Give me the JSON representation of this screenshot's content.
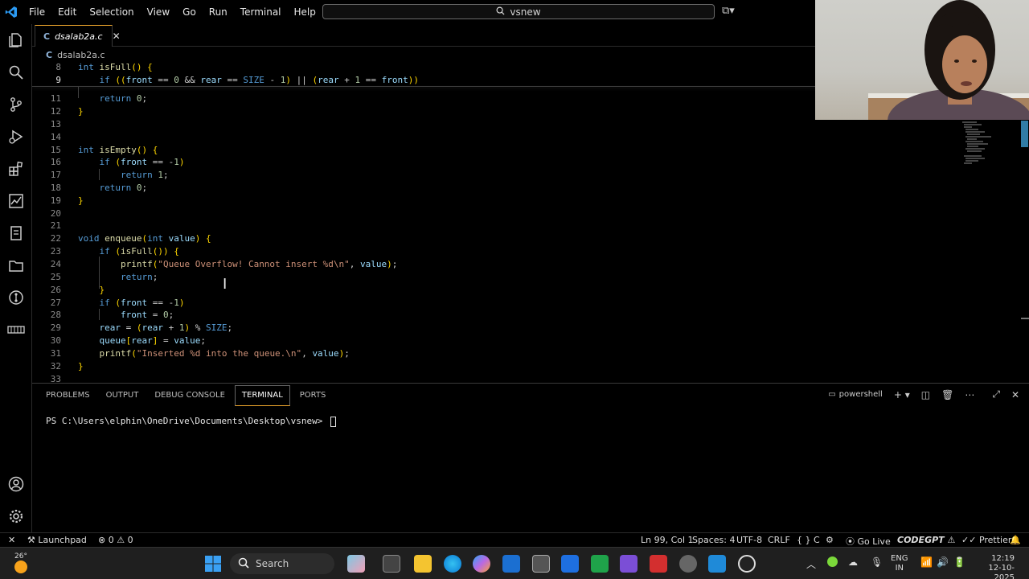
{
  "menu": [
    "File",
    "Edit",
    "Selection",
    "View",
    "Go",
    "Run",
    "Terminal",
    "Help"
  ],
  "command_center": {
    "text": "vsnew"
  },
  "tab": {
    "label": "dsalab2a.c",
    "lang_glyph": "C"
  },
  "breadcrumb": {
    "file": "dsalab2a.c"
  },
  "code_lines": [
    {
      "n": "8",
      "text": "int isFull() {"
    },
    {
      "n": "9",
      "text": "    if ((front == 0 && rear == SIZE - 1) || (rear + 1 == front))"
    },
    {
      "n": "11",
      "text": "    return 0;"
    },
    {
      "n": "12",
      "text": "}"
    },
    {
      "n": "13",
      "text": ""
    },
    {
      "n": "14",
      "text": ""
    },
    {
      "n": "15",
      "text": "int isEmpty() {"
    },
    {
      "n": "16",
      "text": "    if (front == -1)"
    },
    {
      "n": "17",
      "text": "        return 1;"
    },
    {
      "n": "18",
      "text": "    return 0;"
    },
    {
      "n": "19",
      "text": "}"
    },
    {
      "n": "20",
      "text": ""
    },
    {
      "n": "21",
      "text": ""
    },
    {
      "n": "22",
      "text": "void enqueue(int value) {"
    },
    {
      "n": "23",
      "text": "    if (isFull()) {"
    },
    {
      "n": "24",
      "text": "        printf(\"Queue Overflow! Cannot insert %d\\n\", value);"
    },
    {
      "n": "25",
      "text": "        return;"
    },
    {
      "n": "26",
      "text": "    }"
    },
    {
      "n": "27",
      "text": "    if (front == -1)"
    },
    {
      "n": "28",
      "text": "        front = 0;"
    },
    {
      "n": "29",
      "text": "    rear = (rear + 1) % SIZE;"
    },
    {
      "n": "30",
      "text": "    queue[rear] = value;"
    },
    {
      "n": "31",
      "text": "    printf(\"Inserted %d into the queue.\\n\", value);"
    },
    {
      "n": "32",
      "text": "}"
    },
    {
      "n": "33",
      "text": ""
    }
  ],
  "panel": {
    "tabs": [
      "PROBLEMS",
      "OUTPUT",
      "DEBUG CONSOLE",
      "TERMINAL",
      "PORTS"
    ],
    "active_tab": "TERMINAL",
    "shell": "powershell",
    "terminal_prompt": "PS C:\\Users\\elphin\\OneDrive\\Documents\\Desktop\\vsnew> "
  },
  "status": {
    "launchpad": "Launchpad",
    "problems": "0",
    "warnings": "0",
    "position": "Ln 99, Col 1",
    "spaces": "Spaces: 4",
    "encoding": "UTF-8",
    "eol": "CRLF",
    "language": "C",
    "golive": "Go Live",
    "codegpt": "CODEGPT",
    "prettier": "Prettier"
  },
  "taskbar": {
    "weather": "26°",
    "search": "Search",
    "lang": "ENG",
    "region": "IN",
    "time": "12:19",
    "date": "12-10-2025"
  },
  "colors": {
    "accent": "#f3aa2d",
    "keyword": "#569cd6",
    "function": "#dcdcaa",
    "variable": "#9cdcfe",
    "string": "#ce9178",
    "number": "#b5cea8"
  }
}
